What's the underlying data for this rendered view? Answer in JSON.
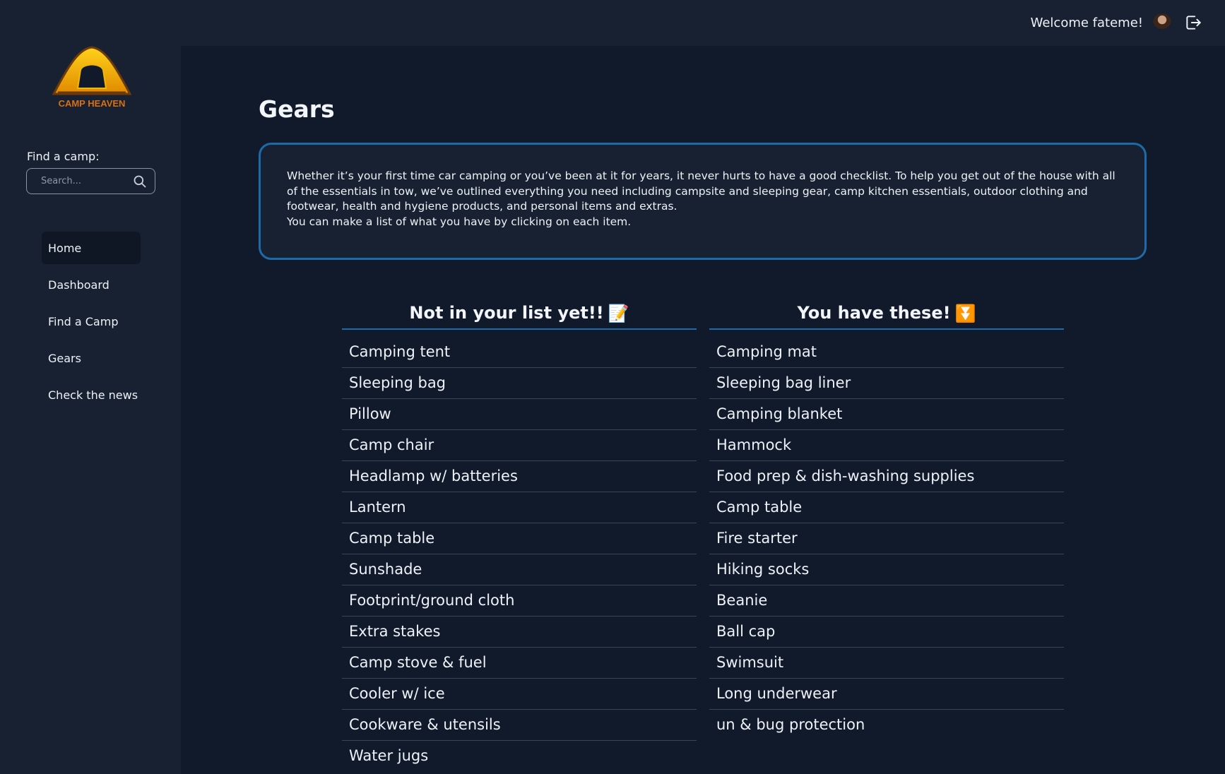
{
  "header": {
    "welcome": "Welcome fateme!",
    "avatar_icon": "user-avatar",
    "logout_icon": "logout-icon"
  },
  "brand": {
    "name": "CAMP HEAVEN",
    "colors": {
      "gold": "#f2b705",
      "orange": "#c8641a"
    }
  },
  "sidebar": {
    "find_label": "Find a camp:",
    "search_placeholder": "Search...",
    "items": [
      {
        "label": "Home",
        "active": true
      },
      {
        "label": "Dashboard",
        "active": false
      },
      {
        "label": "Find a Camp",
        "active": false
      },
      {
        "label": "Gears",
        "active": false
      },
      {
        "label": "Check the news",
        "active": false
      }
    ]
  },
  "main": {
    "title": "Gears",
    "intro": "Whether it’s your first time car camping or you’ve been at it for years, it never hurts to have a good checklist. To help you get out of the house with all of the essentials in tow, we’ve outlined everything you need including campsite and sleeping gear, camp kitchen essentials, outdoor clothing and footwear, health and hygiene products, and personal items and extras.",
    "intro_hint": "You can make a list of what you have by clicking on each item.",
    "not_in_list": {
      "heading": "Not in your list yet!!",
      "emoji": "📝",
      "items": [
        "Camping tent",
        "Sleeping bag",
        "Pillow",
        "Camp chair",
        "Headlamp w/ batteries",
        "Lantern",
        "Camp table",
        "Sunshade",
        "Footprint/ground cloth",
        "Extra stakes",
        "Camp stove & fuel",
        "Cooler w/ ice",
        "Cookware & utensils",
        "Water jugs"
      ]
    },
    "have": {
      "heading": "You have these!",
      "emoji": "⏬",
      "items": [
        "Camping mat",
        "Sleeping bag liner",
        "Camping blanket",
        "Hammock",
        "Food prep & dish-washing supplies",
        "Camp table",
        "Fire starter",
        "Hiking socks",
        "Beanie",
        "Ball cap",
        "Swimsuit",
        "Long underwear",
        "un & bug protection"
      ]
    }
  },
  "colors": {
    "page_bg": "#111a2b",
    "panel_bg": "#172131",
    "accent": "#1e6aa8"
  }
}
